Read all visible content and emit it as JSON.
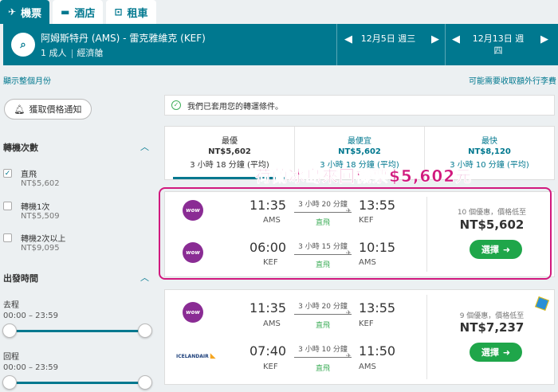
{
  "tabs": [
    {
      "label": "機票",
      "icon": "plane-icon"
    },
    {
      "label": "酒店",
      "icon": "bed-icon"
    },
    {
      "label": "租車",
      "icon": "car-icon"
    }
  ],
  "search": {
    "route": "阿姆斯特丹 (AMS) - 雷克雅維克 (KEF)",
    "passengers": "1 成人",
    "cabin": "經濟艙",
    "depart_date": "12月5日 週三",
    "return_date_line1": "12月13日 週",
    "return_date_line2": "四"
  },
  "links": {
    "month": "顯示整個月份",
    "fees": "可能需要收取額外行李費"
  },
  "sidebar": {
    "alert_button": "獲取價格通知",
    "stops_title": "轉機次數",
    "stops": [
      {
        "label": "直飛",
        "price": "NT$5,602",
        "checked": true
      },
      {
        "label": "轉機1次",
        "price": "NT$5,509",
        "checked": false
      },
      {
        "label": "轉機2次以上",
        "price": "NT$9,095",
        "checked": false
      }
    ],
    "time_title": "出發時間",
    "outbound_label": "去程",
    "outbound_range": "00:00 – 23:59",
    "return_label": "回程",
    "return_range": "00:00 – 23:59"
  },
  "notice": "我們已套用您的轉運條件。",
  "sort_tabs": [
    {
      "label": "最優",
      "price": "NT$5,602",
      "duration": "3 小時 18 分鐘 (平均)"
    },
    {
      "label": "最便宜",
      "price": "NT$5,602",
      "duration": "3 小時 18 分鐘 (平均)"
    },
    {
      "label": "最快",
      "price": "NT$8,120",
      "duration": "3 小時 10 分鐘 (平均)"
    }
  ],
  "overlay_text": "荷蘭冰島來回機票$5,602元",
  "results": [
    {
      "legs": [
        {
          "airline": "WOW",
          "dep_time": "11:35",
          "dep_code": "AMS",
          "duration": "3 小時 20 分鐘",
          "stops": "直飛",
          "arr_time": "13:55",
          "arr_code": "KEF"
        },
        {
          "airline": "WOW",
          "dep_time": "06:00",
          "dep_code": "KEF",
          "duration": "3 小時 15 分鐘",
          "stops": "直飛",
          "arr_time": "10:15",
          "arr_code": "AMS"
        }
      ],
      "deals": "10 個優惠，價格低至",
      "price": "NT$5,602",
      "select": "選擇"
    },
    {
      "legs": [
        {
          "airline": "WOW",
          "dep_time": "11:35",
          "dep_code": "AMS",
          "duration": "3 小時 20 分鐘",
          "stops": "直飛",
          "arr_time": "13:55",
          "arr_code": "KEF"
        },
        {
          "airline": "ICELANDAIR",
          "dep_time": "07:40",
          "dep_code": "KEF",
          "duration": "3 小時 10 分鐘",
          "stops": "直飛",
          "arr_time": "11:50",
          "arr_code": "AMS"
        }
      ],
      "deals": "9 個優惠，價格低至",
      "price": "NT$7,237",
      "select": "選擇"
    }
  ],
  "colors": {
    "accent": "#00788f",
    "highlight": "#d1197e",
    "select": "#1fa64a",
    "wow": "#8a2c94"
  }
}
